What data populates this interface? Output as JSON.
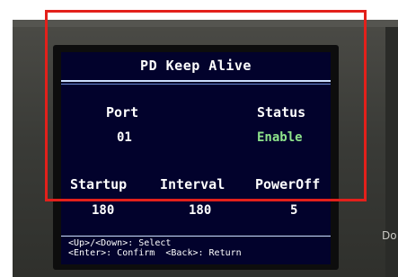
{
  "screen": {
    "title": "PD Keep Alive",
    "port_label": "Port",
    "port_value": "01",
    "status_label": "Status",
    "status_value": "Enable",
    "startup_label": "Startup",
    "startup_value": "180",
    "interval_label": "Interval",
    "interval_value": "180",
    "poweroff_label": "PowerOff",
    "poweroff_value": "5",
    "footer_line1": "<Up>/<Down>: Select",
    "footer_line2": "<Enter>: Confirm  <Back>: Return"
  },
  "device": {
    "side_label": "Do"
  },
  "colors": {
    "lcd_bg": "#02022c",
    "status_enable": "#8ee38b",
    "highlight_box": "#e3201b"
  }
}
